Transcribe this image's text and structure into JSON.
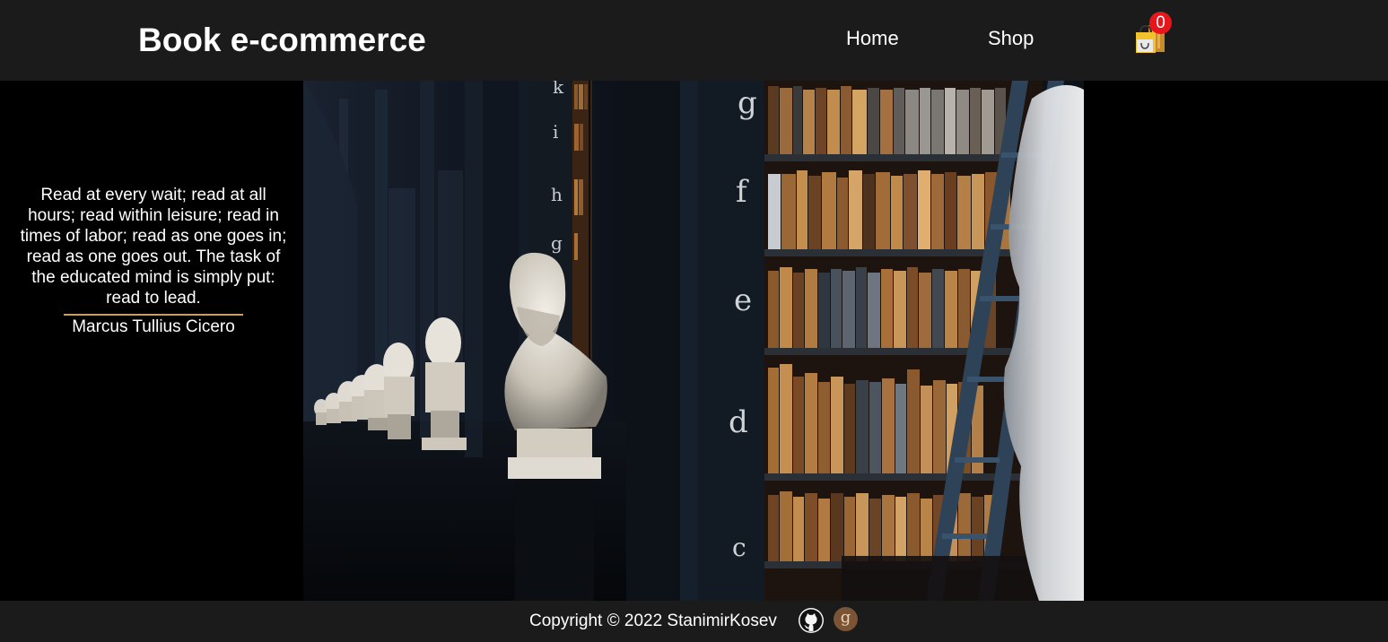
{
  "header": {
    "brand": "Book e-commerce",
    "nav": [
      {
        "label": "Home"
      },
      {
        "label": "Shop"
      }
    ],
    "cart": {
      "count": "0",
      "icon": "shopping-bag-icon"
    }
  },
  "quote": {
    "text": "Read at every wait; read at all hours; read within leisure; read in times of labor; read as one goes in; read as one goes out. The task of the educated mind is simply put: read to lead.",
    "author": "Marcus Tullius Cicero"
  },
  "hero": {
    "shelf_letters": [
      "k",
      "i",
      "h",
      "g",
      "g",
      "f",
      "e",
      "d",
      "c"
    ]
  },
  "footer": {
    "copyright": "Copyright © 2022 StanimirKosev",
    "github_icon": "github-icon",
    "goodreads_icon": "goodreads-icon",
    "goodreads_glyph": "g"
  },
  "colors": {
    "bar_background": "#1b1b1b",
    "page_background": "#000000",
    "badge": "#e8151a",
    "divider": "#c9a062"
  }
}
